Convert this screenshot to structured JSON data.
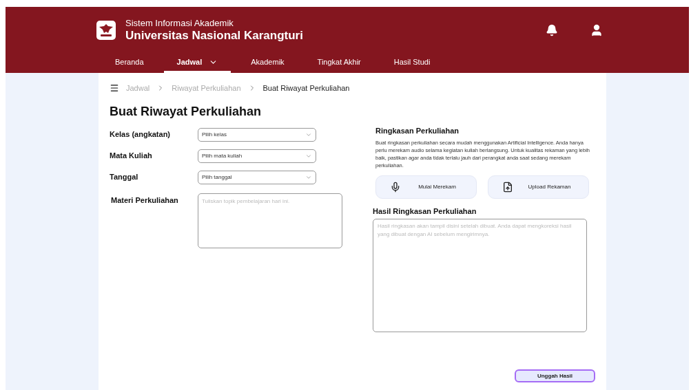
{
  "header": {
    "subtitle": "Sistem Informasi Akademik",
    "title": "Universitas Nasional Karangturi"
  },
  "nav": [
    {
      "label": "Beranda",
      "selected": false,
      "dropdown": false
    },
    {
      "label": "Jadwal",
      "selected": true,
      "dropdown": true
    },
    {
      "label": "Akademik",
      "selected": false,
      "dropdown": false
    },
    {
      "label": "Tingkat Akhir",
      "selected": false,
      "dropdown": false
    },
    {
      "label": "Hasil Studi",
      "selected": false,
      "dropdown": false
    }
  ],
  "breadcrumb": [
    {
      "label": "Jadwal",
      "current": false
    },
    {
      "label": "Riwayat Perkuliahan",
      "current": false
    },
    {
      "label": "Buat Riwayat Perkuliahan",
      "current": true
    }
  ],
  "page_title": "Buat Riwayat Perkuliahan",
  "form": [
    {
      "kind": "select",
      "label": "Kelas (angkatan)",
      "placeholder": "Pilih kelas"
    },
    {
      "kind": "select",
      "label": "Mata Kuliah",
      "placeholder": "Pilih mata kuliah"
    },
    {
      "kind": "select",
      "label": "Tanggal",
      "placeholder": "Pilih tanggal"
    },
    {
      "kind": "textarea",
      "label": "Materi Perkuliahan",
      "placeholder": "Tuliskan topik pembelajaran hari ini."
    }
  ],
  "summary": {
    "title": "Ringkasan Perkuliahan",
    "description": "Buat ringkasan perkuliahan secara mudah menggunakan Artificial Intelligence. Anda hanya perlu merekam audio selama kegiatan kuliah berlangsung. Untuk kualitas rekaman yang lebih baik, pastikan agar anda tidak terlalu jauh dari perangkat anda saat sedang merekam perkuliahan.",
    "buttons": [
      {
        "kind": "record",
        "label": "Mulai Merekam"
      },
      {
        "kind": "upload",
        "label": "Upload Rekaman"
      }
    ],
    "result_title": "Hasil Ringkasan Perkuliahan",
    "result_placeholder": "Hasil ringkasan akan tampil disini setelah dibuat. Anda dapat mengkoreksi hasil yang dibuat dengan AI sebelum mengirimnya."
  },
  "submit": "Unggah Hasil"
}
